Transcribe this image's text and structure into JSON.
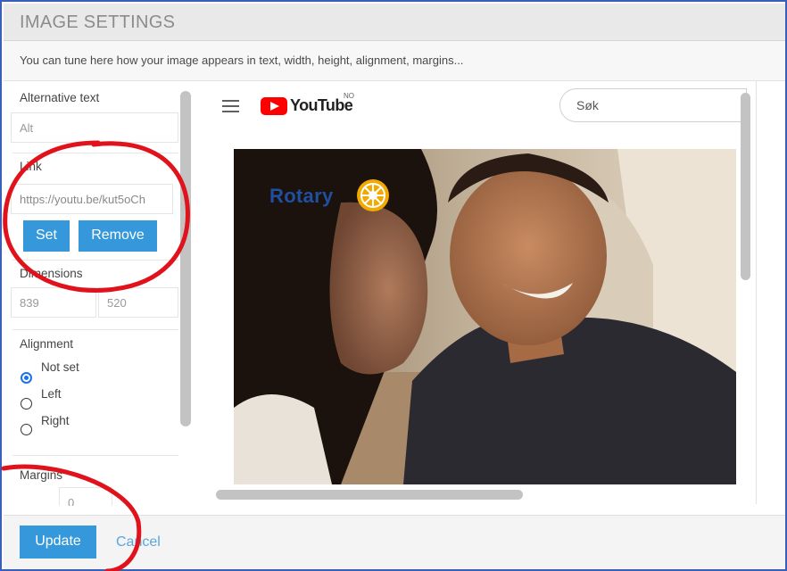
{
  "dialog": {
    "title": "IMAGE SETTINGS",
    "description": "You can tune here how your image appears in text, width, height, alignment, margins..."
  },
  "settings": {
    "alt_label": "Alternative text",
    "alt_placeholder": "Alt",
    "link_label": "Link",
    "link_value": "https://youtu.be/kut5oCh",
    "set_button": "Set",
    "remove_button": "Remove",
    "dimensions_label": "Dimensions",
    "width_value": "839",
    "height_value": "520",
    "alignment_label": "Alignment",
    "alignment_options": [
      "Not set",
      "Left",
      "Right"
    ],
    "alignment_selected": "Not set",
    "margins_label": "Margins",
    "margin_value": "0"
  },
  "preview": {
    "youtube_wordmark": "YouTube",
    "country_code": "NO",
    "search_placeholder": "Søk",
    "logo_text": "Rotary"
  },
  "footer": {
    "update_button": "Update",
    "cancel_link": "Cancel"
  },
  "colors": {
    "accent": "#3498db",
    "annotation": "#e0121b",
    "youtube_red": "#ff0000",
    "rotary_blue": "#1e4fa0",
    "rotary_gold": "#f2a900"
  }
}
